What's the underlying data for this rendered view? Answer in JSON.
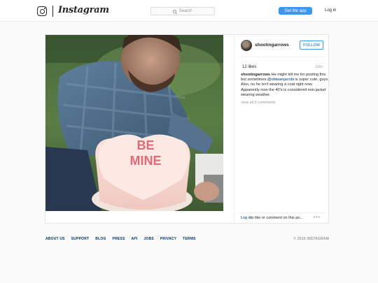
{
  "header": {
    "logo_text": "Instagram",
    "search_placeholder": "Search",
    "get_app_label": "Get the app",
    "login_label": "Log in"
  },
  "post": {
    "username": "shootingarrows",
    "follow_label": "FOLLOW",
    "likes": "12 likes",
    "time": "10m",
    "caption": {
      "username": "shootingarrows",
      "before_mention": "He might kill me for posting this but sometimes",
      "mention": "@obiwanjacobi",
      "after_mention": "is super cute, guys. Also, no he isn't wearing a coat right now. Apparently now the 40's is considered non-jacket wearing weather."
    },
    "view_comments": "view all 3 comments",
    "login_link": "Log in",
    "comment_prompt": "to like or comment on this po...",
    "more_glyph": "•••",
    "photo_text": [
      "BE",
      "MINE"
    ]
  },
  "footer": {
    "links": [
      "ABOUT US",
      "SUPPORT",
      "BLOG",
      "PRESS",
      "API",
      "JOBS",
      "PRIVACY",
      "TERMS"
    ],
    "copyright": "© 2016 INSTAGRAM"
  },
  "colors": {
    "accent": "#3897f0",
    "link": "#003569",
    "muted": "#999999",
    "background": "#fafafa"
  },
  "icons": {
    "logo": "instagram-camera-icon",
    "search": "search-icon",
    "more": "more-options-icon"
  }
}
